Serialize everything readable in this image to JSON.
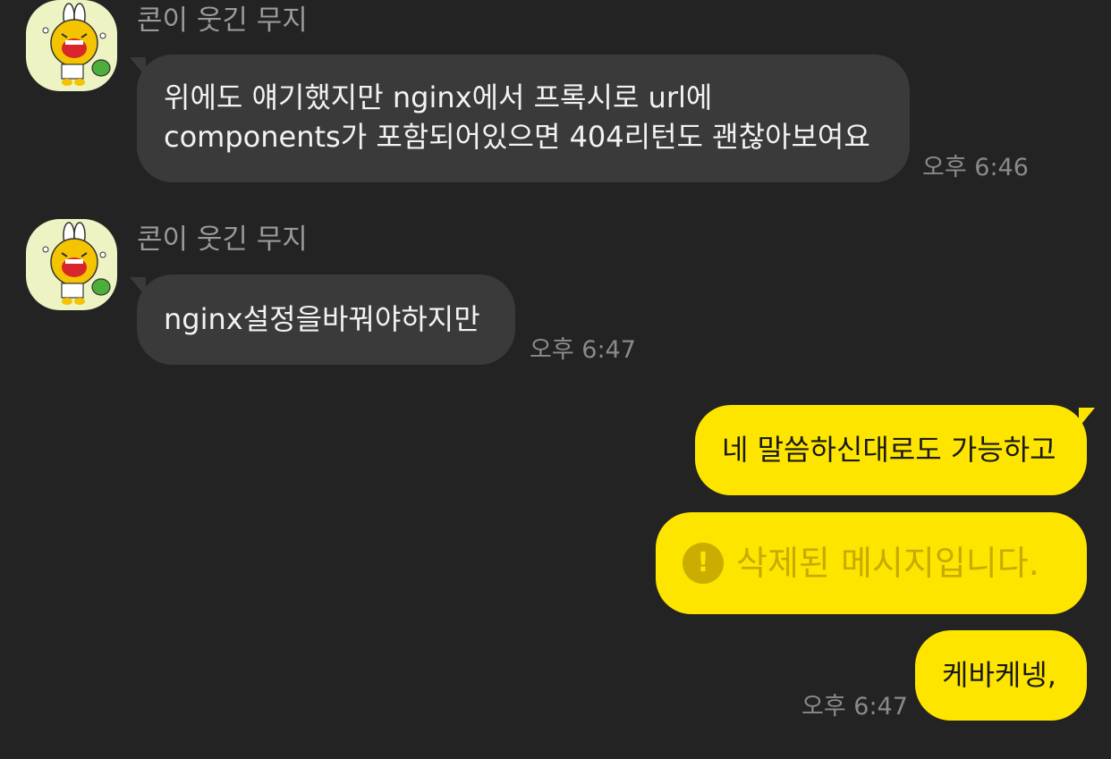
{
  "colors": {
    "background": "#232323",
    "incoming_bubble": "#3a3a3a",
    "outgoing_bubble": "#fee500",
    "deleted_text": "#c7ab00"
  },
  "messages": [
    {
      "sender": "콘이 웃긴 무지",
      "avatar_icon": "muzi-laughing-icon",
      "lines": [
        "위에도 얘기했지만 nginx에서 프록시로 url에",
        "components가 포함되어있으면 404리턴도 괜찮아보여요"
      ],
      "time": "오후 6:46"
    },
    {
      "sender": "콘이 웃긴 무지",
      "avatar_icon": "muzi-laughing-icon",
      "text": "nginx설정을바꿔야하지만",
      "time": "오후 6:47"
    }
  ],
  "my_messages": [
    {
      "text": "네 말씀하신대로도 가능하고"
    },
    {
      "text": "삭제된 메시지입니다.",
      "icon": "exclamation-circle-icon"
    },
    {
      "text": "케바케넹,",
      "time": "오후 6:47"
    }
  ]
}
